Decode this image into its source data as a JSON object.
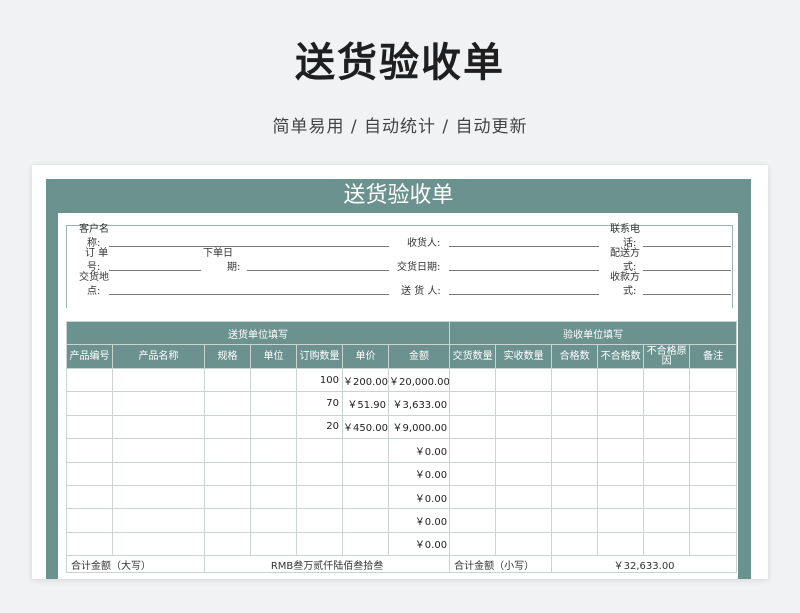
{
  "header": {
    "title": "送货验收单",
    "subtitle": "简单易用 / 自动统计 / 自动更新"
  },
  "sheet": {
    "title": "送货验收单",
    "info": {
      "customer_top": "客户名",
      "customer_bottom": "称:",
      "order_top": "订 单",
      "order_bottom": "号:",
      "address_top": "交货地",
      "address_bottom": "点:",
      "order_date_top": "下单日",
      "order_date_bottom": "期:",
      "receiver": "收货人:",
      "delivery_date": "交货日期:",
      "sender": "送 货 人:",
      "phone_top": "联系电",
      "phone_bottom": "话:",
      "ship_top": "配送方",
      "ship_bottom": "式:",
      "pay_top": "收款方",
      "pay_bottom": "式:"
    },
    "sections": {
      "delivery": "送货单位填写",
      "acceptance": "验收单位填写"
    },
    "columns": [
      "产品编号",
      "产品名称",
      "规格",
      "单位",
      "订购数量",
      "单价",
      "金额",
      "交货数量",
      "实收数量",
      "合格数",
      "不合格数",
      "不合格原因",
      "备注"
    ],
    "rows": [
      {
        "qty": "100",
        "price": "￥200.00",
        "amount": "￥20,000.00"
      },
      {
        "qty": "70",
        "price": "￥51.90",
        "amount": "￥3,633.00"
      },
      {
        "qty": "20",
        "price": "￥450.00",
        "amount": "￥9,000.00"
      },
      {
        "qty": "",
        "price": "",
        "amount": "￥0.00"
      },
      {
        "qty": "",
        "price": "",
        "amount": "￥0.00"
      },
      {
        "qty": "",
        "price": "",
        "amount": "￥0.00"
      },
      {
        "qty": "",
        "price": "",
        "amount": "￥0.00"
      },
      {
        "qty": "",
        "price": "",
        "amount": "￥0.00"
      }
    ],
    "totals": {
      "upper_label": "合计金额（大写）",
      "upper_value": "RMB叁万贰仟陆佰叁拾叁",
      "lower_label": "合计金额（小写）",
      "lower_value": "￥32,633.00"
    }
  },
  "colors": {
    "accent": "#6c9290",
    "total_red": "#c0141a"
  }
}
